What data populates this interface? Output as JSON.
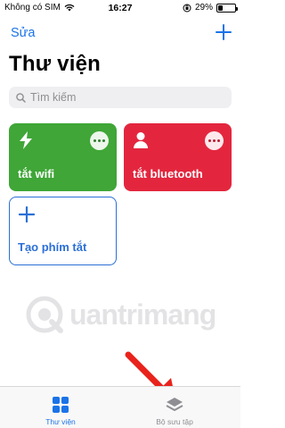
{
  "status_bar": {
    "carrier": "Không có SIM",
    "time": "16:27",
    "battery_percent": "29%",
    "battery_level": 0.29
  },
  "nav": {
    "edit_label": "Sửa",
    "add_icon": "plus-icon"
  },
  "page_title": "Thư viện",
  "search": {
    "placeholder": "Tìm kiếm"
  },
  "shortcuts": [
    {
      "label": "tắt wifi",
      "icon": "bolt-icon",
      "color": "#3fa637"
    },
    {
      "label": "tắt bluetooth",
      "icon": "person-icon",
      "color": "#e3263e"
    }
  ],
  "new_shortcut": {
    "label": "Tạo phím tắt",
    "icon": "plus-icon",
    "color": "#2b6fd6"
  },
  "watermark": "uantrimang",
  "tabs": [
    {
      "label": "Thư viện",
      "icon": "grid-icon",
      "active": true
    },
    {
      "label": "Bộ sưu tập",
      "icon": "layers-icon",
      "active": false
    }
  ],
  "accent_color": "#1a73e8"
}
